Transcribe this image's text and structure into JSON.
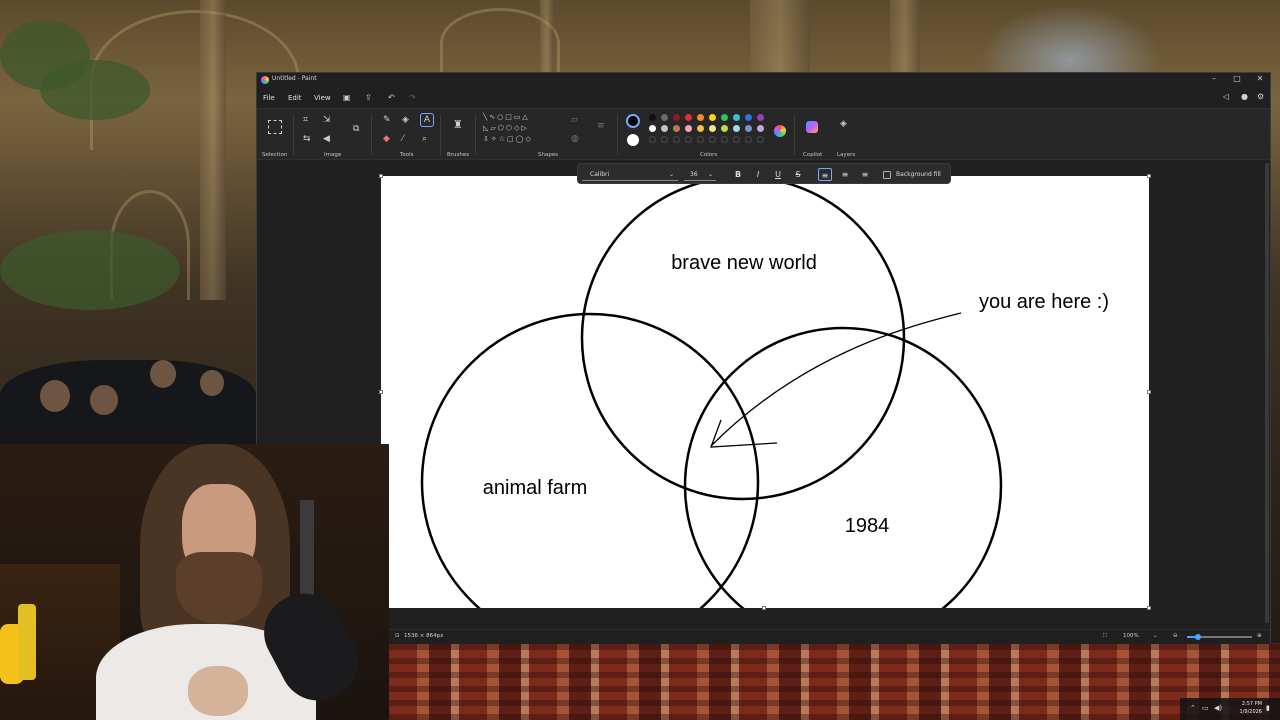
{
  "window": {
    "title": "Untitled - Paint",
    "controls": {
      "minimize": "–",
      "maximize": "□",
      "close": "✕"
    }
  },
  "menu": {
    "file": "File",
    "edit": "Edit",
    "view": "View"
  },
  "ribbon": {
    "groups": {
      "selection": "Selection",
      "image": "Image",
      "tools": "Tools",
      "brushes": "Brushes",
      "shapes": "Shapes",
      "colors": "Colors",
      "copilot": "Copilot",
      "layers": "Layers"
    },
    "palette_row1": [
      "#111111",
      "#6b6b6b",
      "#8a1b2a",
      "#e12d39",
      "#f08c2b",
      "#f7d21c",
      "#2fc25b",
      "#33c2d6",
      "#2f72e0",
      "#8e44ad"
    ],
    "palette_row2": [
      "#ffffff",
      "#c4c4c4",
      "#b77b5c",
      "#f2a5b7",
      "#f5c242",
      "#f0e68c",
      "#b8e04a",
      "#9edbe6",
      "#7a93c9",
      "#c3a6e0"
    ],
    "primary_color": "#000000",
    "secondary_color": "#ffffff"
  },
  "text_toolbar": {
    "font": "Calibri",
    "size": "36",
    "bold": "B",
    "italic": "I",
    "underline": "U",
    "strike": "S",
    "background_fill": "Background fill"
  },
  "canvas": {
    "labels": {
      "top": "brave new world",
      "left": "animal farm",
      "right": "1984",
      "arrow_note": "you are here :)"
    }
  },
  "statusbar": {
    "dimensions": "1536 × 864px",
    "zoom": "100%"
  },
  "taskbar": {
    "time": "2:57 PM",
    "date": "1/9/2026"
  }
}
